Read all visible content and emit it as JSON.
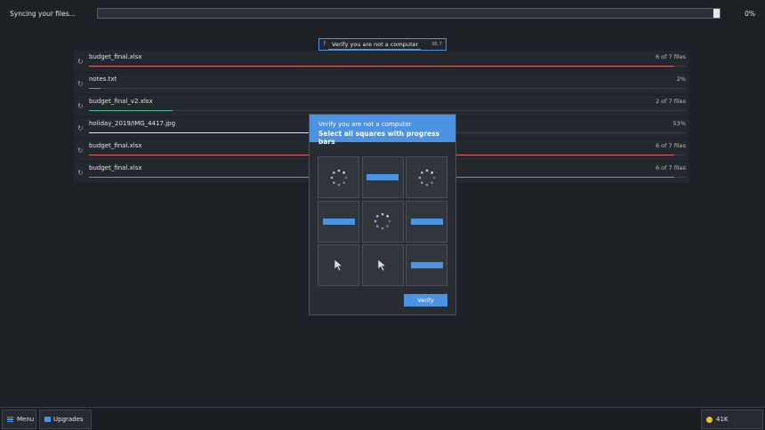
{
  "sync": {
    "label": "Syncing your files...",
    "percent_label": "0%",
    "progress": 0.0
  },
  "mini_captcha": {
    "question_mark": "?",
    "title": "Verify you are not a computer",
    "timer": "36.7",
    "progress": 0.72
  },
  "files": [
    {
      "name": "budget_final.xlsx",
      "status": "6 of 7 files",
      "progress": 0.98,
      "color": "#e06b6b"
    },
    {
      "name": "notes.txt",
      "status": "2%",
      "progress": 0.02,
      "color": "#e06b6b"
    },
    {
      "name": "budget_final_v2.xlsx",
      "status": "2 of 7 files",
      "progress": 0.14,
      "color": "#3ec28f"
    },
    {
      "name": "holiday_2019/IMG_4417.jpg",
      "status": "53%",
      "progress": 0.53,
      "color": "#e6e8eb"
    },
    {
      "name": "budget_final.xlsx",
      "status": "6 of 7 files",
      "progress": 0.98,
      "color": "#e06b6b"
    },
    {
      "name": "budget_final.xlsx",
      "status": "6 of 7 files",
      "progress": 0.98,
      "color": "#e06b6b"
    }
  ],
  "captcha": {
    "title": "Verify you are not a computer",
    "instruction": "Select all squares with progress bars",
    "tiles": [
      "spinner-icon",
      "progress-bar-icon",
      "spinner-icon",
      "progress-bar-icon",
      "spinner-icon",
      "progress-bar-icon",
      "cursor-icon",
      "cursor-icon",
      "progress-bar-icon"
    ],
    "verify_label": "Verify",
    "accent": "#4c93e4"
  },
  "taskbar": {
    "menu_label": "Menu",
    "upgrades_label": "Upgrades",
    "coins": "41K"
  }
}
